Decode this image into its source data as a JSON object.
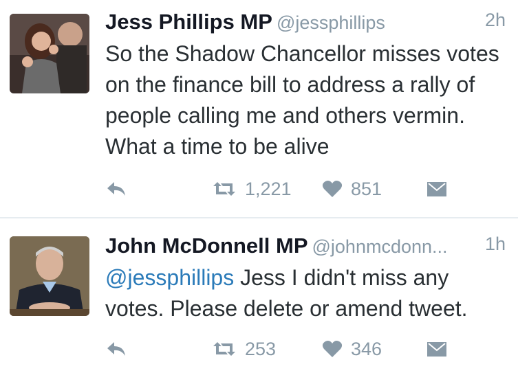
{
  "tweets": [
    {
      "name": "Jess Phillips MP",
      "handle": "@jessphillips",
      "time": "2h",
      "text": "So the Shadow Chancellor misses votes on the finance bill to address a rally of people calling me and others vermin. What a time to be alive",
      "retweets": "1,221",
      "likes": "851"
    },
    {
      "name": "John McDonnell MP",
      "handle": "@johnmcdonn...",
      "time": "1h",
      "mention": "@jessphillips",
      "text": " Jess I didn't miss any votes. Please delete or amend tweet.",
      "retweets": "253",
      "likes": "346"
    }
  ],
  "colors": {
    "text": "#292f33",
    "muted": "#8899a6",
    "link": "#2b7bb9",
    "divider": "#e6ecf0"
  },
  "icons": [
    "reply-icon",
    "retweet-icon",
    "heart-icon",
    "direct-message-icon"
  ]
}
